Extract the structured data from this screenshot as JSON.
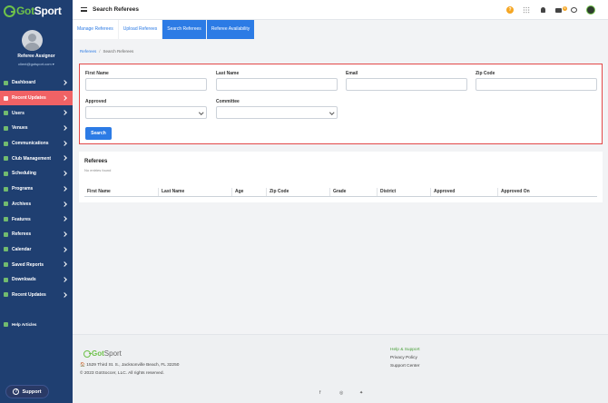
{
  "brand": {
    "logo_text_a": "Got",
    "logo_text_b": "Sport"
  },
  "user": {
    "name": "Referee Assignor",
    "email": "client@gotsport.com ▾"
  },
  "sidebar": {
    "items": [
      {
        "label": "Dashboard"
      },
      {
        "label": "Recent Updates"
      },
      {
        "label": "Users"
      },
      {
        "label": "Venues"
      },
      {
        "label": "Communications"
      },
      {
        "label": "Club Management"
      },
      {
        "label": "Scheduling"
      },
      {
        "label": "Programs"
      },
      {
        "label": "Archives"
      },
      {
        "label": "Features"
      },
      {
        "label": "Referees"
      },
      {
        "label": "Calendar"
      },
      {
        "label": "Saved Reports"
      },
      {
        "label": "Downloads"
      },
      {
        "label": "Recent Updates"
      }
    ],
    "help_articles": "Help Articles",
    "support": "Support"
  },
  "header": {
    "title": "Search Referees",
    "mail_badge": "6"
  },
  "tabs": [
    {
      "label": "Manage Referees"
    },
    {
      "label": "Upload Referees"
    },
    {
      "label": "Search Referees"
    },
    {
      "label": "Referee Availability"
    }
  ],
  "breadcrumb": {
    "root": "Referees",
    "current": "Search Referees",
    "sep": "/"
  },
  "search_form": {
    "first_name_label": "First Name",
    "last_name_label": "Last Name",
    "email_label": "Email",
    "zip_label": "Zip Code",
    "approved_label": "Approved",
    "committee_label": "Committee",
    "search_button": "Search"
  },
  "results": {
    "title": "Referees",
    "empty_text": "No entries found",
    "columns": [
      "First Name",
      "Last Name",
      "Age",
      "Zip Code",
      "Grade",
      "District",
      "Approved",
      "Approved On"
    ]
  },
  "footer": {
    "logo_a": "Got",
    "logo_b": "Sport",
    "address": "🏠 1529 Third St. S., Jacksonville Beach, FL 32250",
    "copyright": "© 2023 GotSoccer, LLC. All rights reserved.",
    "links": [
      "Help & Support",
      "Privacy Policy",
      "Support Center"
    ],
    "social": [
      "f",
      "◎",
      "✦"
    ]
  }
}
